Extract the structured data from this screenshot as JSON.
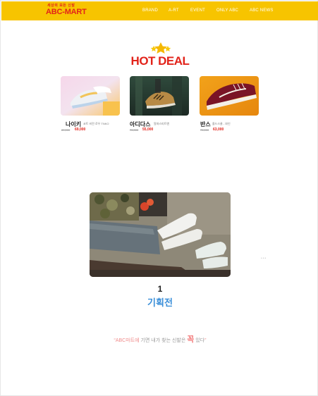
{
  "header": {
    "logo_tagline": "세상의 모든 신발",
    "logo_text": "ABC-MART",
    "nav": [
      "BRAND",
      "A-RT",
      "EVENT",
      "ONLY ABC",
      "ABC NEWS"
    ]
  },
  "hot_deal": {
    "title": "HOT DEAL",
    "products": [
      {
        "name": "나이키",
        "desc": "코트 비전 로우 TNKO",
        "old_price": "89,000",
        "price": "69,000"
      },
      {
        "name": "아디다스",
        "desc": "알파스피트엔",
        "old_price": "75,000",
        "price": "55,000"
      },
      {
        "name": "반스",
        "desc": "올드스쿨 - 와인",
        "old_price": "75,000",
        "price": "63,000"
      }
    ]
  },
  "feature": {
    "number": "1",
    "label": "기획전"
  },
  "slogan": {
    "open_quote": "“",
    "brand": "ABC마트에",
    "middle": " 기면 내가 찾는 신발은 ",
    "emphasis": "꼭",
    "end": " 있다",
    "close_quote": "”"
  },
  "colors": {
    "header_yellow": "#f7c400",
    "brand_red": "#e2231a",
    "accent_blue": "#3b8fd9"
  }
}
